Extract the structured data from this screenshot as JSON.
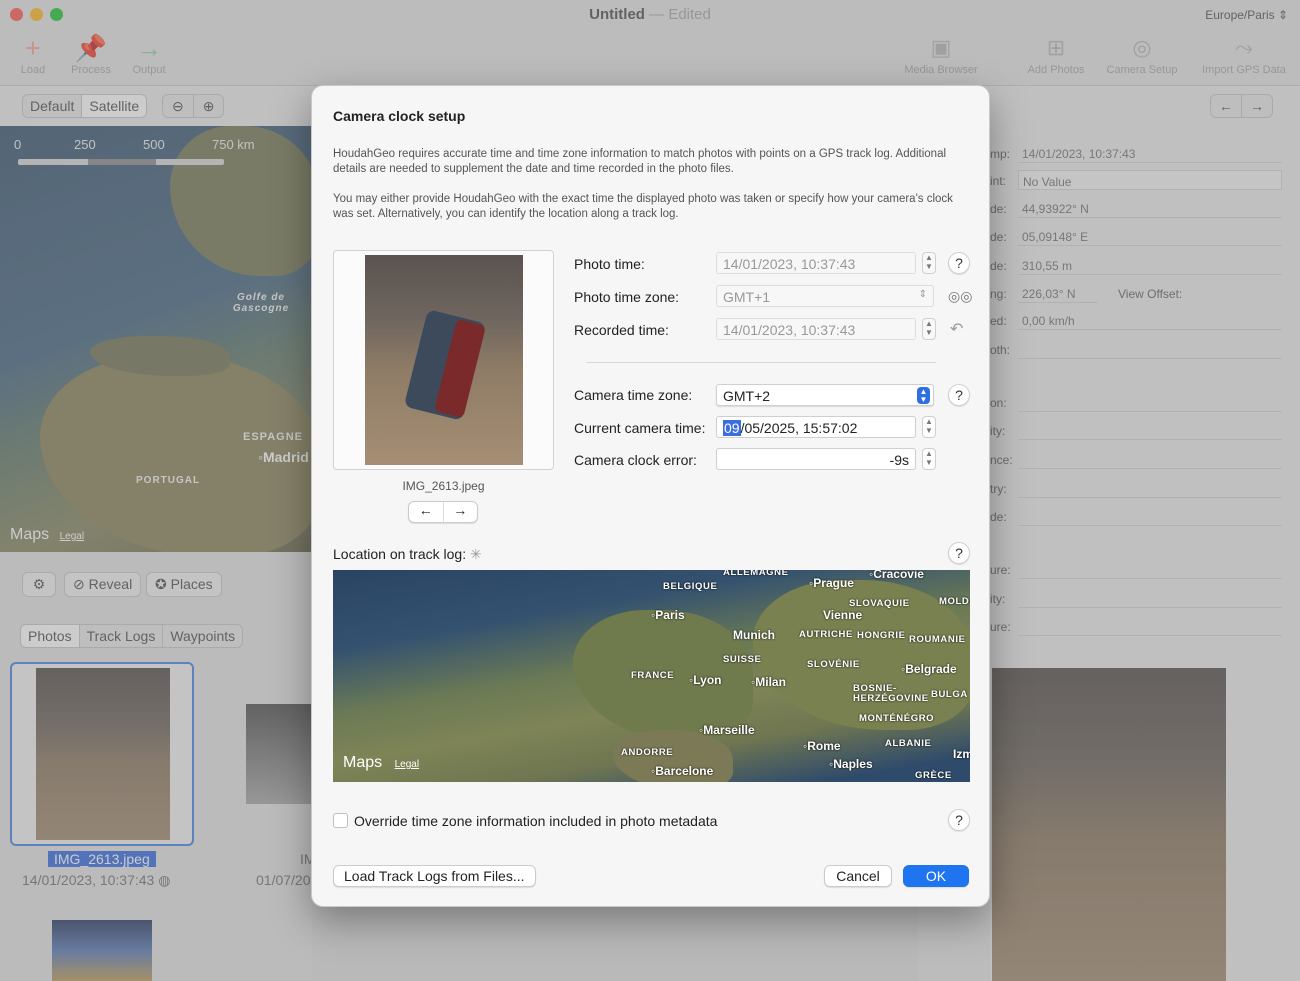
{
  "window": {
    "title": "Untitled",
    "edited": "Edited",
    "timezone": "Europe/Paris"
  },
  "toolbar": {
    "left": [
      {
        "label": "Load",
        "icon": "plus-icon"
      },
      {
        "label": "Process",
        "icon": "pin-icon"
      },
      {
        "label": "Output",
        "icon": "arrow-right-icon"
      }
    ],
    "right": [
      {
        "label": "Media Browser",
        "icon": "media-icon"
      },
      {
        "label": "Add Photos",
        "icon": "add-photo-icon"
      },
      {
        "label": "Camera Setup",
        "icon": "camera-icon"
      },
      {
        "label": "Import GPS Data",
        "icon": "gps-import-icon"
      }
    ]
  },
  "map_view": {
    "default_label": "Default",
    "satellite_label": "Satellite",
    "scale": [
      "0",
      "250",
      "500",
      "750 km"
    ],
    "places": [
      "Golfe de Gascogne",
      "ESPAGNE",
      "Madrid",
      "PORTUGAL"
    ],
    "maps_logo": "Maps",
    "legal": "Legal"
  },
  "sidebar": {
    "reveal": "Reveal",
    "places": "Places",
    "tabs": [
      "Photos",
      "Track Logs",
      "Waypoints"
    ],
    "photo1_name": "IMG_2613.jpeg",
    "photo1_date": "14/01/2023, 10:37:43",
    "photo2_name": "IM",
    "photo2_date": "01/07/20"
  },
  "inspector": {
    "rows": [
      {
        "label": "mp:",
        "value": "14/01/2023, 10:37:43"
      },
      {
        "label": "int:",
        "value": "No Value"
      },
      {
        "label": "de:",
        "value": "44,93922° N"
      },
      {
        "label": "de:",
        "value": "05,09148° E"
      },
      {
        "label": "de:",
        "value": "310,55 m"
      },
      {
        "label": "ng:",
        "value": "226,03° N"
      },
      {
        "label": "ed:",
        "value": "0,00 km/h"
      },
      {
        "label": "oth:",
        "value": ""
      },
      {
        "label": "on:",
        "value": ""
      },
      {
        "label": "ity:",
        "value": ""
      },
      {
        "label": "nce:",
        "value": ""
      },
      {
        "label": "try:",
        "value": ""
      },
      {
        "label": "de:",
        "value": ""
      },
      {
        "label": "ure:",
        "value": ""
      },
      {
        "label": "ity:",
        "value": ""
      },
      {
        "label": "ure:",
        "value": ""
      }
    ],
    "view_offset": "View Offset:"
  },
  "dialog": {
    "title": "Camera clock setup",
    "para1": "HoudahGeo requires accurate time and time zone information to match photos with points on a GPS track log. Additional details are needed to supplement the date and time recorded in the photo files.",
    "para2": "You may either provide HoudahGeo with the exact time the displayed photo was taken or specify how your camera's clock was set. Alternatively, you can identify the location along a track log.",
    "photo_name": "IMG_2613.jpeg",
    "photo_time_label": "Photo time:",
    "photo_time": "14/01/2023, 10:37:43",
    "photo_tz_label": "Photo time zone:",
    "photo_tz": "GMT+1",
    "recorded_label": "Recorded time:",
    "recorded_time": "14/01/2023, 10:37:43",
    "camera_tz_label": "Camera time zone:",
    "camera_tz": "GMT+2",
    "current_time_label": "Current camera time:",
    "current_time_sel": "09",
    "current_time_rest": "/05/2025, 15:57:02",
    "clock_error_label": "Camera clock error:",
    "clock_error": "-9s",
    "location_label": "Location on track log:",
    "override_label": "Override time zone information included in photo metadata",
    "load_button": "Load Track Logs from Files...",
    "cancel_button": "Cancel",
    "ok_button": "OK",
    "help_glyph": "?",
    "map": {
      "countries": [
        "BELGIQUE",
        "FRANCE",
        "SUISSE",
        "AUTRICHE",
        "SLOVAQUIE",
        "HONGRIE",
        "ROUMANIE",
        "SLOVÉNIE",
        "BOSNIE-HERZÉGOVINE",
        "MONTÉNÉGRO",
        "ALBANIE",
        "ANDORRE",
        "GRÈCE",
        "MOLDA",
        "BULGA",
        "ALLEMAGNE"
      ],
      "cities": [
        "Prague",
        "Cracovie",
        "Paris",
        "Vienne",
        "Munich",
        "Lyon",
        "Milan",
        "Belgrade",
        "Marseille",
        "Rome",
        "Naples",
        "Barcelone",
        "Izm"
      ],
      "logo": "Maps",
      "legal": "Legal"
    }
  }
}
